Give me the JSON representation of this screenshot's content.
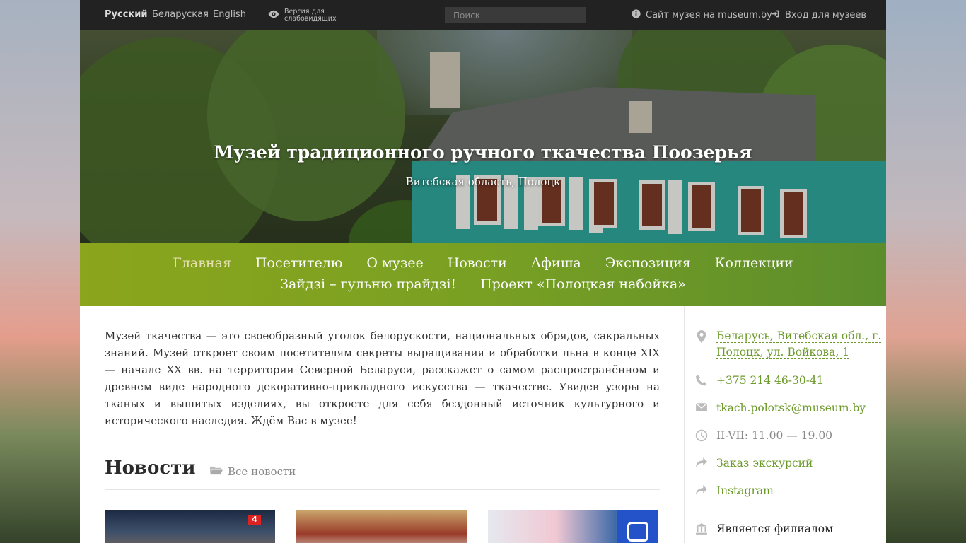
{
  "topbar": {
    "languages": [
      "Русский",
      "Беларуская",
      "English"
    ],
    "accessibility_label": "Версия для слабовидящих",
    "search_placeholder": "Поиск",
    "museum_site_link": "Сайт музея на museum.by",
    "login_link": "Вход для музеев"
  },
  "hero": {
    "title": "Музей традиционного ручного ткачества Поозерья",
    "subtitle": "Витебская область, Полоцк"
  },
  "nav": {
    "row1": [
      "Главная",
      "Посетителю",
      "О музее",
      "Новости",
      "Афиша",
      "Экспозиция",
      "Коллекции"
    ],
    "row2": [
      "Зайдзі – гульню прайдзі!",
      "Проект «Полоцкая набойка»"
    ],
    "active": "Главная"
  },
  "intro": "Музей ткачества — это своеобразный уголок белорускости, национальных обрядов, сакральных знаний. Музей откроет своим посетителям секреты выращивания и обработки льна в конце XIX — начале XX вв. на территории Северной Беларуси, расскажет о самом распространённом и древнем виде народного декоративно-прикладного искусства — ткачестве. Увидев узоры на тканых и вышитых изделиях, вы откроете для себя бездонный источник культурного и исторического наследия. Ждём Вас в музее!",
  "news": {
    "title": "Новости",
    "all_link": "Все новости",
    "card1_badge": "4"
  },
  "sidebar": {
    "address_line1": "Беларусь, Витебская обл., г.",
    "address_line2": "Полоцк, ул. Войкова, 1",
    "phone": "+375 214 46-30-41",
    "email": "tkach.polotsk@museum.by",
    "hours": "II-VII: 11.00 — 19.00",
    "excursions": "Заказ экскурсий",
    "instagram": "Instagram",
    "branch_label": "Является филиалом"
  },
  "colors": {
    "accent_green": "#6c9a2a",
    "nav_gradient_start": "#8ba51c",
    "nav_gradient_end": "#5c8d2c",
    "topbar_bg": "#222222"
  }
}
